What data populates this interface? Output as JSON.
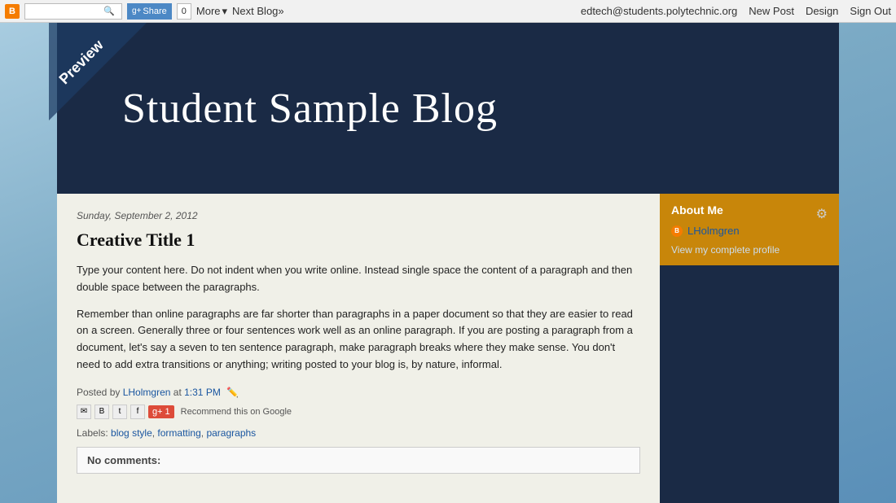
{
  "topbar": {
    "logo_letter": "B",
    "share_label": "Share",
    "share_count": "0",
    "more_label": "More",
    "more_chevron": "▾",
    "next_blog_label": "Next Blog»",
    "email": "edtech@students.polytechnic.org",
    "new_post_label": "New Post",
    "design_label": "Design",
    "sign_out_label": "Sign Out"
  },
  "preview": {
    "ribbon_label": "Preview"
  },
  "header": {
    "blog_title": "Student Sample Blog"
  },
  "post": {
    "date": "Sunday, September 2, 2012",
    "title": "Creative Title 1",
    "body_p1": "Type your content here. Do not indent when you write online. Instead single space the content of a paragraph and then double space between the paragraphs.",
    "body_p2": "Remember than online paragraphs are far shorter than paragraphs in a paper document so that they are easier to read on a screen. Generally three or four sentences work well as an online paragraph. If you are posting a paragraph from a document, let's say a seven to ten sentence paragraph, make paragraph breaks where they make sense. You don't need to add extra transitions or anything; writing posted to your blog is, by nature, informal.",
    "posted_by_label": "Posted by",
    "author": "LHolmgren",
    "at_label": "at",
    "time": "1:31 PM",
    "recommend_label": "Recommend this on Google",
    "labels_label": "Labels:",
    "label1": "blog style",
    "label2": "formatting",
    "label3": "paragraphs",
    "no_comments": "No comments:"
  },
  "sidebar": {
    "about_me_title": "About Me",
    "profile_name": "LHolmgren",
    "profile_link": "View my complete profile"
  }
}
